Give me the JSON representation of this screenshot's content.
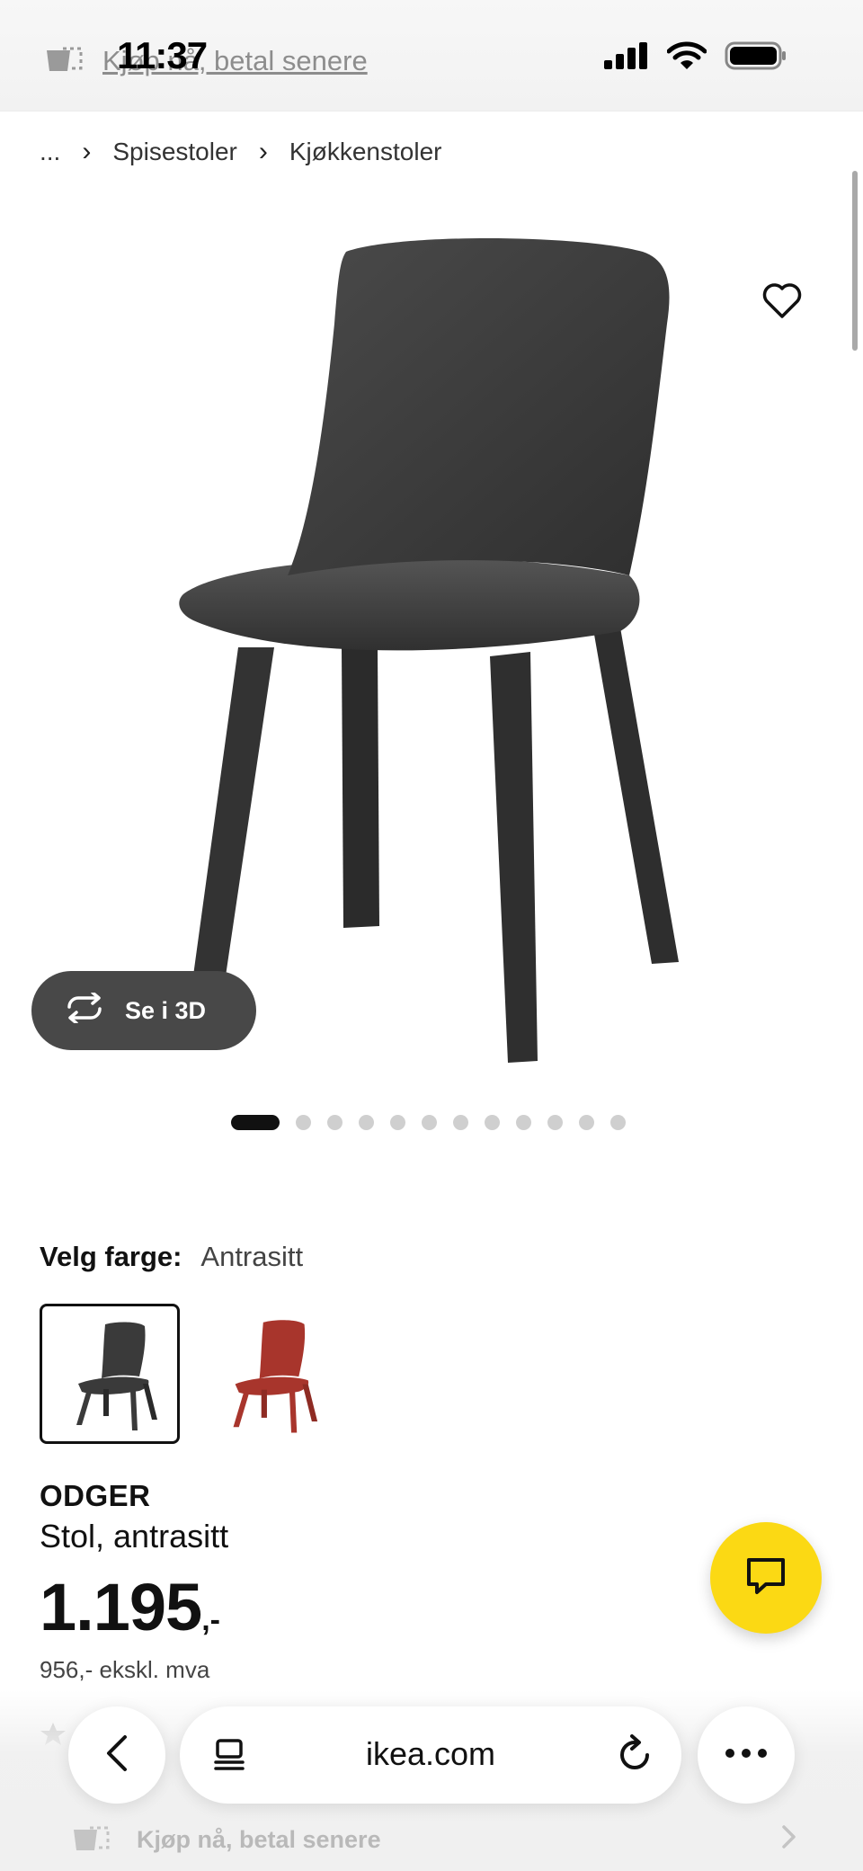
{
  "status_bar": {
    "time": "11:37"
  },
  "top_promo": {
    "text": "Kjøp nå, betal senere"
  },
  "breadcrumb": {
    "ellipsis": "...",
    "items": [
      "Spisestoler",
      "Kjøkkenstoler"
    ]
  },
  "gallery": {
    "view_3d_label": "Se i 3D",
    "image_count": 12,
    "active_index": 0
  },
  "color_picker": {
    "label": "Velg farge:",
    "selected_value": "Antrasitt",
    "swatches": [
      {
        "name": "Antrasitt",
        "color": "#3a3a3a",
        "selected": true
      },
      {
        "name": "Rød",
        "color": "#a8352c",
        "selected": false
      }
    ]
  },
  "product": {
    "name": "ODGER",
    "description": "Stol, antrasitt",
    "price": "1.195",
    "price_suffix": ",-",
    "price_ex_vat": "956,- ekskl. mva"
  },
  "browser": {
    "url": "ikea.com"
  },
  "bottom_promo": {
    "text": "Kjøp nå, betal senere"
  },
  "colors": {
    "accent_yellow": "#fbd914",
    "chair_dark": "#3a3a3a",
    "chair_red": "#a8352c"
  }
}
